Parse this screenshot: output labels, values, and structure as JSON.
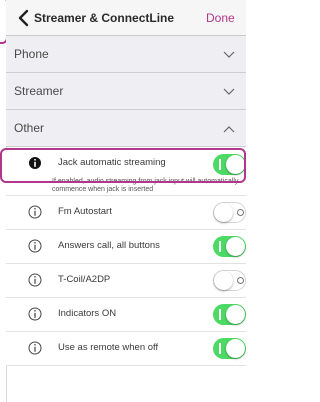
{
  "navbar": {
    "title": "Streamer & ConnectLine",
    "done_label": "Done"
  },
  "sections": [
    {
      "label": "Phone",
      "expanded": false
    },
    {
      "label": "Streamer",
      "expanded": false
    },
    {
      "label": "Other",
      "expanded": true
    }
  ],
  "rows": [
    {
      "label": "Jack automatic streaming",
      "on": true,
      "info_filled": true,
      "description": "If enabled, audio streaming from jack input will automatically commence when jack is inserted"
    },
    {
      "label": "Fm Autostart",
      "on": false,
      "info_filled": false
    },
    {
      "label": "Answers call, all buttons",
      "on": true,
      "info_filled": false
    },
    {
      "label": "T-Coil/A2DP",
      "on": false,
      "info_filled": false
    },
    {
      "label": "Indicators ON",
      "on": true,
      "info_filled": false
    },
    {
      "label": "Use as remote when off",
      "on": true,
      "info_filled": false
    }
  ],
  "colors": {
    "accent": "#b0378b",
    "toggle_on": "#4cd964"
  }
}
